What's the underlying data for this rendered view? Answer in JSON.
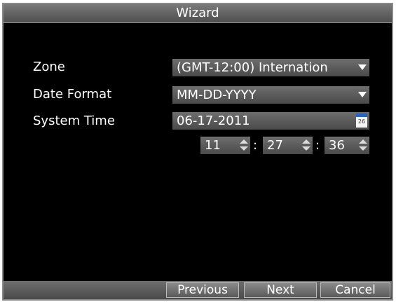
{
  "window": {
    "title": "Wizard"
  },
  "form": {
    "zone": {
      "label": "Zone",
      "value": "(GMT-12:00) Internation"
    },
    "date_format": {
      "label": "Date Format",
      "value": "MM-DD-YYYY"
    },
    "system_time": {
      "label": "System Time",
      "date": "06-17-2011",
      "calendar_day": "26",
      "hour": "11",
      "minute": "27",
      "second": "36",
      "separator": ":"
    }
  },
  "buttons": {
    "previous": "Previous",
    "next": "Next",
    "cancel": "Cancel"
  },
  "icons": {
    "dropdown": "chevron-down-icon",
    "calendar": "calendar-icon",
    "spinner": "spinner-arrows-icon"
  },
  "colors": {
    "background": "#000000",
    "titlebar": "#5e5e5e",
    "field": "#5c5c5c",
    "text": "#ffffff"
  }
}
